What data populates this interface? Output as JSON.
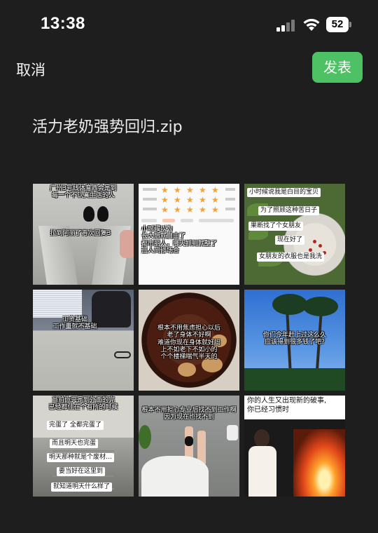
{
  "status_bar": {
    "time": "13:38",
    "battery": "52"
  },
  "nav": {
    "cancel_label": "取消",
    "publish_label": "发表"
  },
  "attachment": {
    "file_name": "活力老奶强势回归.zip"
  },
  "grid": {
    "tiles": [
      {
        "caption": [
          "广州3号线体育西会是到",
          "每一个不认真生活的人"
        ],
        "overlay": "拉到阿丽了再次回复3"
      },
      {
        "caption": [
          "小时候以为",
          "长大后就自由了",
          "都市丽人，哪天抓到就整了",
          "巡人间修场合"
        ]
      },
      {
        "caption": [
          "小时候说我是白目的宝贝",
          "为了照顾这种苦日子",
          "果断找了个女朋友",
          "现在好了",
          "女朋友的衣服也是我洗"
        ]
      },
      {
        "caption": [
          "工资基础",
          "工作量就不基础"
        ]
      },
      {
        "caption": [
          "根本不用焦虑担心以后",
          "老了身体不好啊",
          "难道你现在身体就好吗",
          "上不如老下不如小的",
          "个个楼梯喘气半天的"
        ]
      },
      {
        "caption": [
          "你们今年赶上过这么久",
          "应该得到很多钱了吧?"
        ]
      },
      {
        "caption": [
          "当前你只是到外面的完",
          "已经都住在个有所的时候"
        ],
        "stack": [
          "完蛋了 全都完蛋了",
          "而且明天也完蛋",
          "明天那种就是个废材…",
          "要当好在这里到",
          "就知道明天什么样了"
        ]
      },
      {
        "caption": [
          "根本不用担心专业后找不到工作啊",
          "因为现在也找不到"
        ]
      },
      {
        "caption": [
          "你的人生又出现新的破事,",
          "你已经习惯时"
        ]
      }
    ]
  }
}
